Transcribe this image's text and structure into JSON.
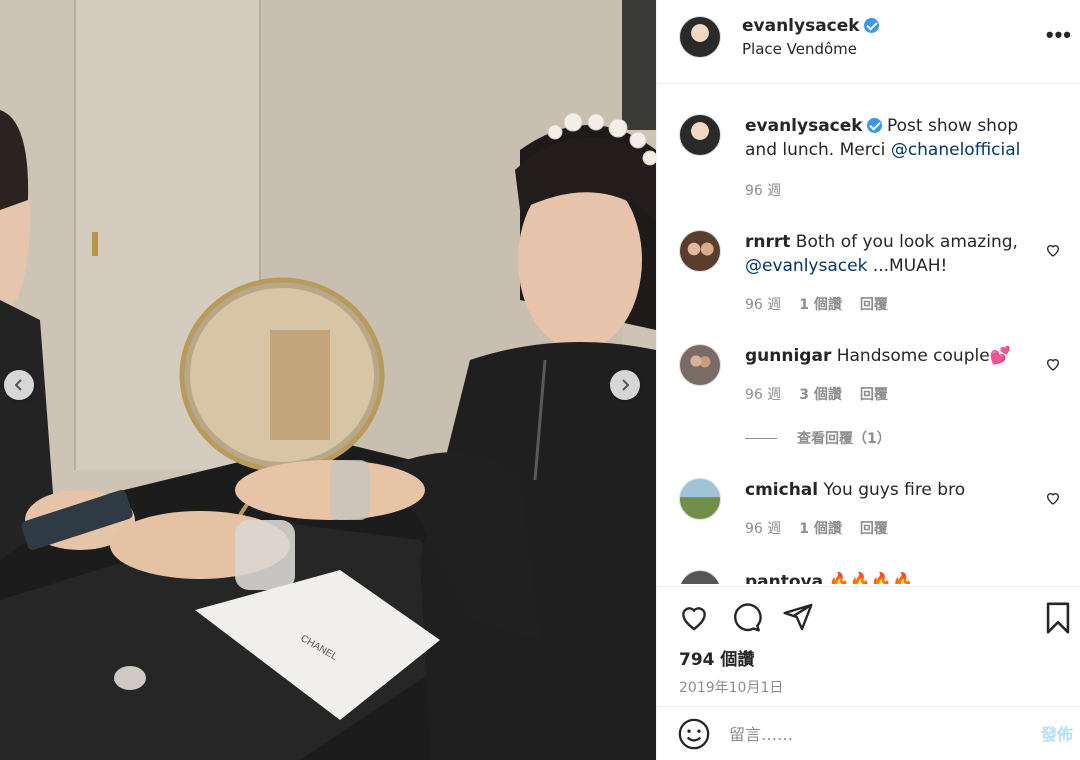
{
  "post": {
    "username": "evanlysacek",
    "location": "Place Vendôme",
    "more_label": "•••"
  },
  "caption": {
    "username": "evanlysacek",
    "text": "Post show shop and lunch. Merci ",
    "mention": "@chanelofficial",
    "time": "96 週"
  },
  "comments": [
    {
      "username": "rnrrt",
      "text_before": "Both of you look amazing, ",
      "mention": "@evanlysacek",
      "text_after": " ...MUAH!",
      "time": "96 週",
      "likes": "1 個讚",
      "reply": "回覆"
    },
    {
      "username": "gunnigar",
      "text": "Handsome couple💕",
      "time": "96 週",
      "likes": "3 個讚",
      "reply": "回覆",
      "view_replies": "查看回覆（1）"
    },
    {
      "username": "cmichal",
      "text": "You guys fire bro",
      "time": "96 週",
      "likes": "1 個讚",
      "reply": "回覆"
    },
    {
      "username": "pantoya",
      "text": "🔥🔥🔥🔥"
    }
  ],
  "stats": {
    "likes": "794 個讚",
    "date": "2019年10月1日"
  },
  "compose": {
    "placeholder": "留言……",
    "post_label": "發佈"
  },
  "icons": {
    "like": "heart-icon",
    "comment": "comment-icon",
    "share": "share-icon",
    "save": "bookmark-icon",
    "emoji": "emoji-icon"
  },
  "colors": {
    "verified": "#3897f0",
    "mention": "#00376b",
    "muted": "#8e8e8e",
    "post_disabled": "#b2dffc"
  }
}
